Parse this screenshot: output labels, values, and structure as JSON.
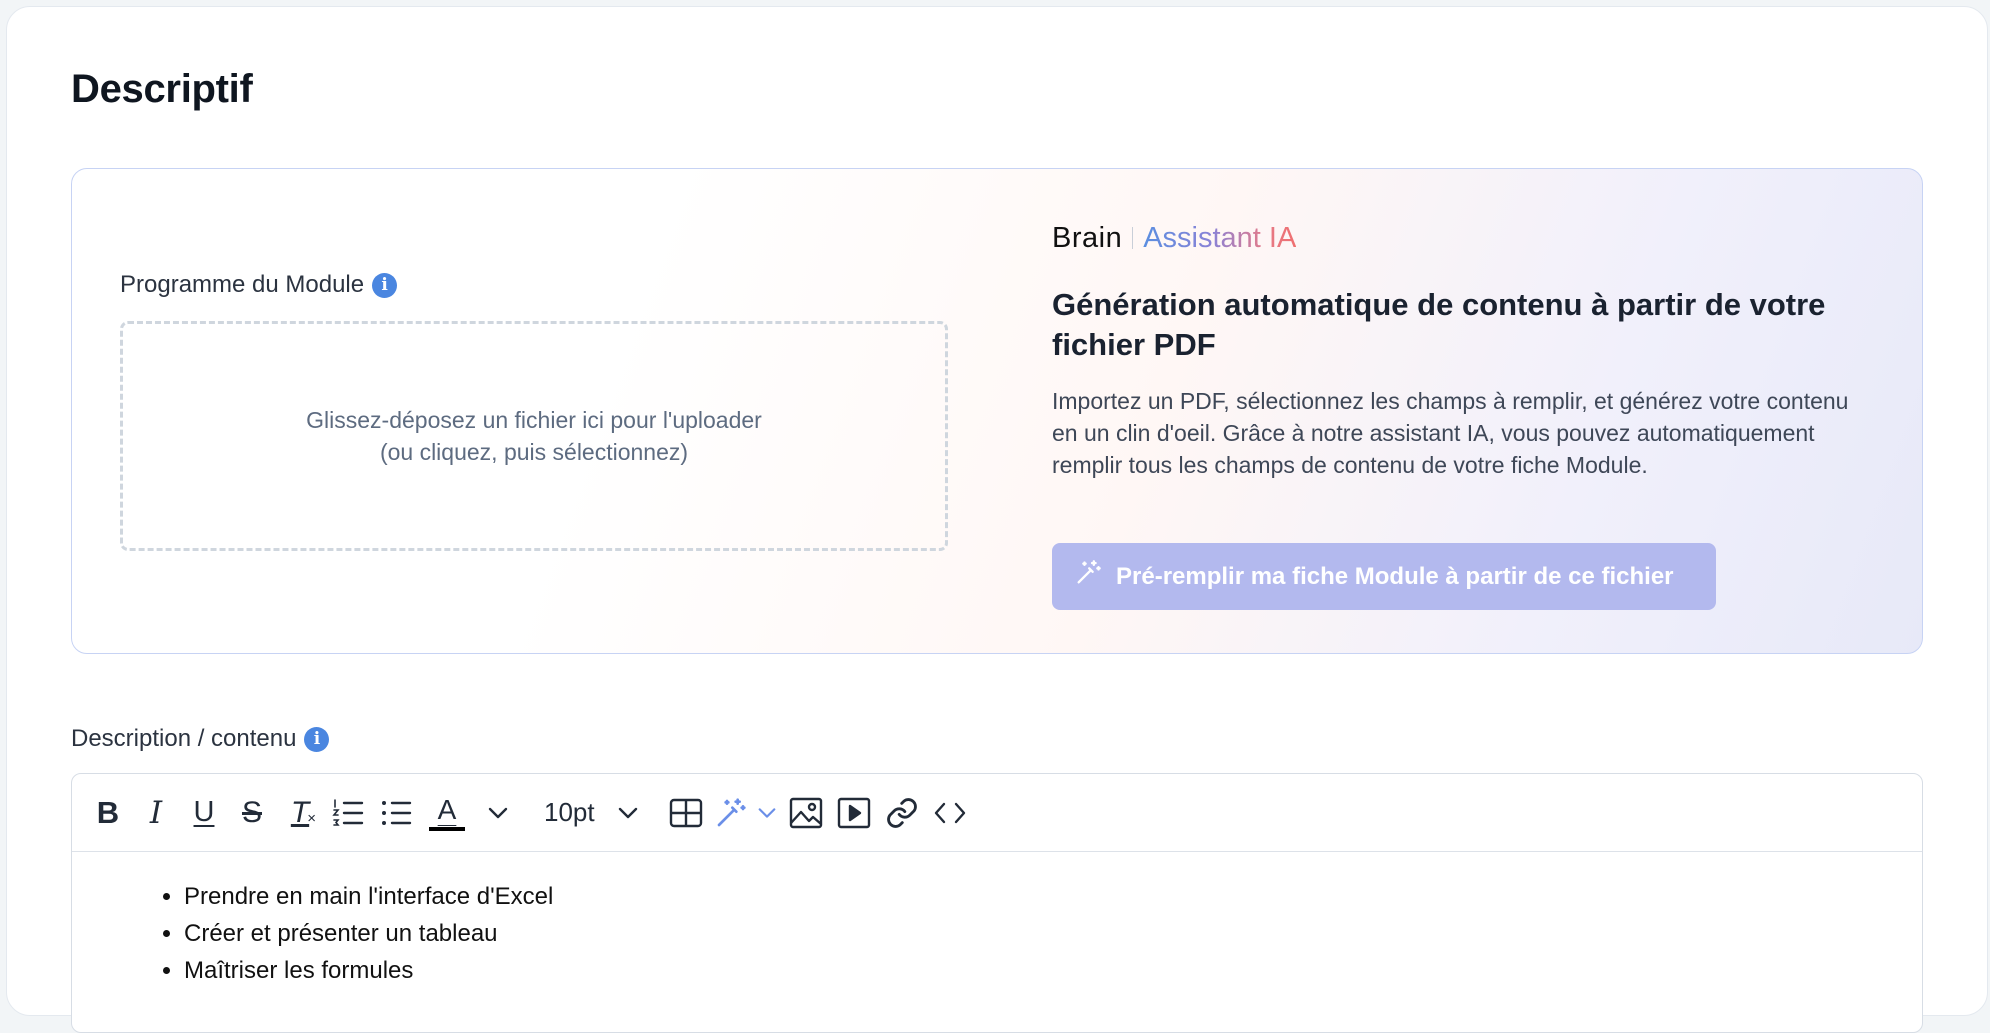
{
  "section": {
    "title": "Descriptif"
  },
  "upload": {
    "label": "Programme du Module",
    "info_icon": "i",
    "drop_line1": "Glissez-déposez un fichier ici pour l'uploader",
    "drop_line2": "(ou cliquez, puis sélectionnez)"
  },
  "assistant": {
    "brand_logo": "Brain",
    "brand_name": "Assistant IA",
    "title": "Génération automatique de contenu à partir de votre fichier PDF",
    "description": "Importez un PDF, sélectionnez les champs à remplir, et générez votre contenu en un clin d'oeil. Grâce à notre assistant IA, vous pouvez automatiquement remplir tous les champs de contenu de votre fiche Module.",
    "button_label": "Pré-remplir ma fiche Module à partir de ce fichier",
    "button_icon": "magic-wand-icon"
  },
  "description_field": {
    "label": "Description / contenu",
    "info_icon": "i",
    "toolbar": {
      "bold": "B",
      "italic": "I",
      "underline": "U",
      "strikethrough": "S",
      "clear_format": "T",
      "text_color": "A",
      "font_size": "10pt"
    },
    "items": [
      "Prendre en main l'interface d'Excel",
      "Créer et présenter un tableau",
      "Maîtriser les formules"
    ]
  },
  "colors": {
    "info_blue": "#4a86e0",
    "button_bg": "#b3b9ee",
    "panel_border": "#c7d3f4"
  }
}
